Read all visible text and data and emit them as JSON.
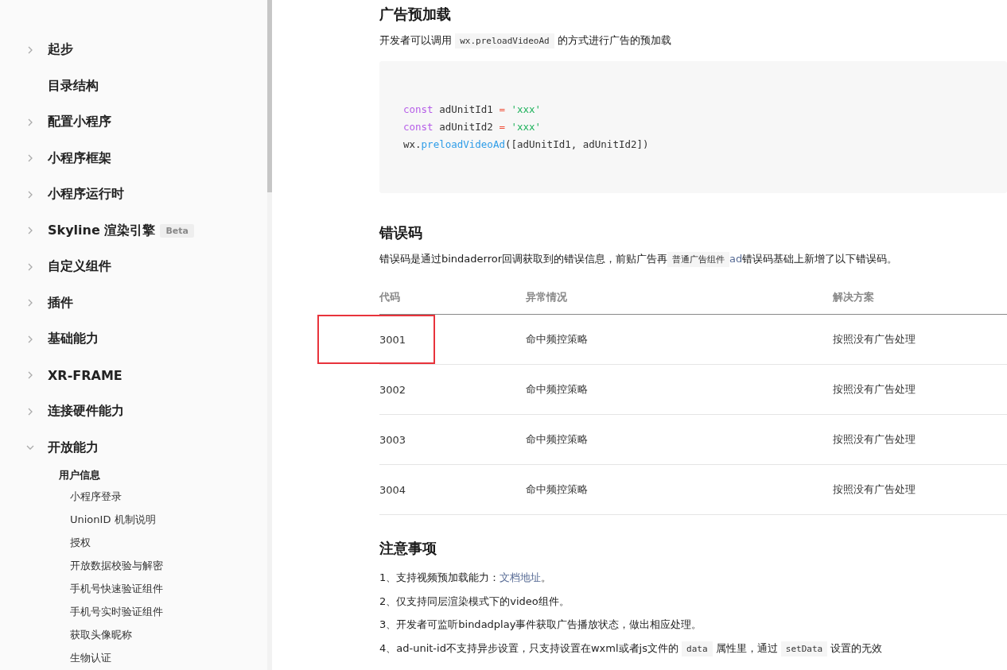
{
  "sidebar": {
    "items": [
      {
        "label": "起步",
        "kind": "folder",
        "expanded": false
      },
      {
        "label": "目录结构",
        "kind": "page"
      },
      {
        "label": "配置小程序",
        "kind": "folder",
        "expanded": false
      },
      {
        "label": "小程序框架",
        "kind": "folder",
        "expanded": false
      },
      {
        "label": "小程序运行时",
        "kind": "folder",
        "expanded": false
      },
      {
        "label": "Skyline 渲染引擎",
        "badge": "Beta",
        "kind": "folder",
        "expanded": false
      },
      {
        "label": "自定义组件",
        "kind": "folder",
        "expanded": false
      },
      {
        "label": "插件",
        "kind": "folder",
        "expanded": false
      },
      {
        "label": "基础能力",
        "kind": "folder",
        "expanded": false
      },
      {
        "label": "XR-FRAME",
        "kind": "folder",
        "expanded": false
      },
      {
        "label": "连接硬件能力",
        "kind": "folder",
        "expanded": false
      },
      {
        "label": "开放能力",
        "kind": "folder",
        "expanded": true,
        "children": [
          {
            "label": "用户信息",
            "children": [
              {
                "label": "小程序登录"
              },
              {
                "label": "UnionID 机制说明"
              },
              {
                "label": "授权"
              },
              {
                "label": "开放数据校验与解密"
              },
              {
                "label": "手机号快速验证组件"
              },
              {
                "label": "手机号实时验证组件"
              },
              {
                "label": "获取头像昵称"
              },
              {
                "label": "生物认证"
              }
            ]
          }
        ]
      }
    ]
  },
  "sections": [
    {
      "title": "广告预加载",
      "paragraph": [
        {
          "kind": "text",
          "text": "开发者可以调用 "
        },
        {
          "kind": "code",
          "text": "wx.preloadVideoAd"
        },
        {
          "kind": "text",
          "text": " 的方式进行广告的预加载"
        }
      ],
      "code_block": [
        [
          {
            "kind": "keyword",
            "text": "const"
          },
          {
            "kind": "plain",
            "text": " adUnitId1 "
          },
          {
            "kind": "operator",
            "text": "="
          },
          {
            "kind": "string",
            "text": " 'xxx'"
          }
        ],
        [
          {
            "kind": "keyword",
            "text": "const"
          },
          {
            "kind": "plain",
            "text": " adUnitId2 "
          },
          {
            "kind": "operator",
            "text": "="
          },
          {
            "kind": "string",
            "text": " 'xxx'"
          }
        ],
        [
          {
            "kind": "plain",
            "text": "wx."
          },
          {
            "kind": "function",
            "text": "preloadVideoAd"
          },
          {
            "kind": "plain",
            "text": "([adUnitId1, adUnitId2])"
          }
        ]
      ]
    },
    {
      "title": "错误码",
      "paragraph": [
        {
          "kind": "text",
          "text": "错误码是通过bindaderror回调获取到的错误信息，前贴广告再"
        },
        {
          "kind": "code",
          "text": "普通广告组件"
        },
        {
          "kind": "link",
          "text": "ad"
        },
        {
          "kind": "text",
          "text": "错误码基础上新增了以下错误码。"
        }
      ],
      "table": {
        "columns": [
          "代码",
          "异常情况",
          "解决方案"
        ],
        "rows": [
          {
            "cells": [
              "3001",
              "命中频控策略",
              "按照没有广告处理"
            ],
            "highlighted": true
          },
          {
            "cells": [
              "3002",
              "命中频控策略",
              "按照没有广告处理"
            ],
            "highlighted": false
          },
          {
            "cells": [
              "3003",
              "命中频控策略",
              "按照没有广告处理"
            ],
            "highlighted": false
          },
          {
            "cells": [
              "3004",
              "命中频控策略",
              "按照没有广告处理"
            ],
            "highlighted": false
          }
        ]
      }
    },
    {
      "title": "注意事项",
      "notes": [
        [
          {
            "kind": "text",
            "text": "1、支持视频预加载能力："
          },
          {
            "kind": "link",
            "text": "文档地址"
          },
          {
            "kind": "text",
            "text": "。"
          }
        ],
        [
          {
            "kind": "text",
            "text": "2、仅支持同层渲染模式下的video组件。"
          }
        ],
        [
          {
            "kind": "text",
            "text": "3、开发者可监听bindadplay事件获取广告播放状态，做出相应处理。"
          }
        ],
        [
          {
            "kind": "text",
            "text": "4、ad-unit-id不支持异步设置，只支持设置在wxml或者js文件的 "
          },
          {
            "kind": "code",
            "text": "data"
          },
          {
            "kind": "text",
            "text": " 属性里，通过 "
          },
          {
            "kind": "code",
            "text": "setData"
          },
          {
            "kind": "text",
            "text": " 设置的无效"
          }
        ]
      ]
    }
  ]
}
